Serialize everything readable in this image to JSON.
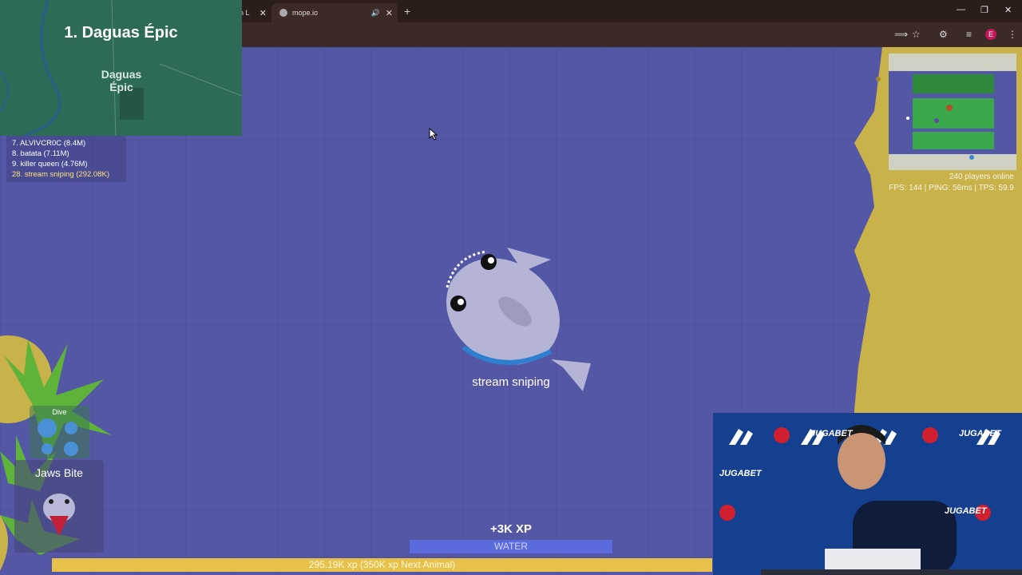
{
  "browser": {
    "tab_prev_fragment": "h L",
    "tab_title": "mope.io",
    "new_tab_label": "+",
    "window_controls": [
      "—",
      "❐",
      "✕"
    ],
    "profile_letter": "E"
  },
  "overlay": {
    "title": "1. Daguas Épic",
    "map_label": "Daguas Épic"
  },
  "leaderboard": {
    "rows": [
      "7. ALVIVCR0C (8.4M)",
      "8. batata (7.11M)",
      "9. killer queen (4.76M)",
      "28. stream sniping (292.08K)"
    ]
  },
  "server": {
    "players_online": "240 players online",
    "perf": "FPS: 144 | PING: 56ms | TPS: 59.9"
  },
  "player": {
    "name": "stream sniping"
  },
  "abilities": {
    "dive_label": "Dive",
    "jaws_label": "Jaws Bite"
  },
  "hud": {
    "xp_popup": "+3K XP",
    "water_label": "WATER",
    "xp_text": "295.19K xp  (350K xp Next Animal)"
  },
  "webcam": {
    "brand": "JUGABET"
  },
  "colors": {
    "ocean": "#5457a6",
    "sand": "#c9b24a",
    "xp_bar": "#e8c14b",
    "water_bar": "#5b6bdb"
  }
}
